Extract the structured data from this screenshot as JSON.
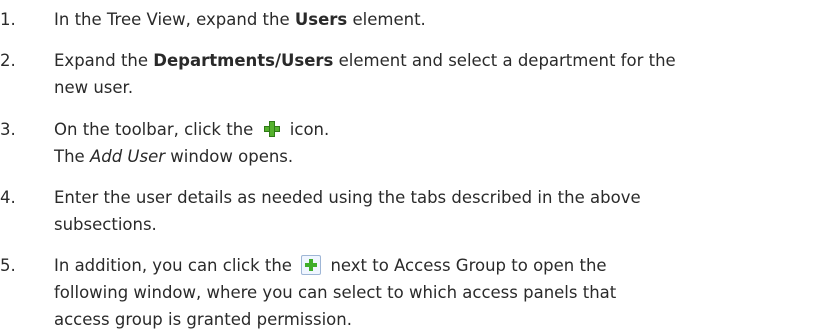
{
  "steps": [
    {
      "num": "1.",
      "pre": "In the Tree View, expand the ",
      "bold": "Users",
      "post": " element."
    },
    {
      "num": "2.",
      "pre": "Expand the ",
      "bold": "Departments/Users",
      "post_line1": " element and select a department for the",
      "post_line2": "new user."
    },
    {
      "num": "3.",
      "pre": "On the toolbar, click the ",
      "icon": "add-icon",
      "post": " icon.",
      "note_italic": "Add User",
      "note_rest": " window opens.",
      "note_pre": "The "
    },
    {
      "num": "4.",
      "line1": "Enter the user details as needed using the tabs described in the above",
      "line2": "subsections."
    },
    {
      "num": "5.",
      "pre": "In addition, you can click the ",
      "icon": "add-box-icon",
      "post": " next to Access Group to open the",
      "line2": "following window, where you can select to which access panels that",
      "line3": "access group is granted permission."
    }
  ]
}
